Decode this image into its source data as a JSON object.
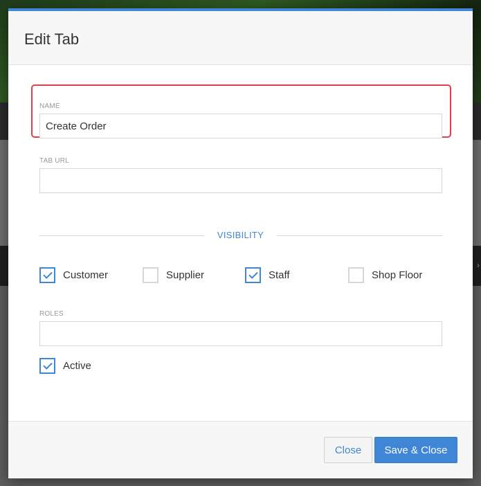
{
  "dialog": {
    "title": "Edit Tab"
  },
  "fields": {
    "name": {
      "label": "NAME",
      "value": "Create Order",
      "placeholder": ""
    },
    "tab_url": {
      "label": "TAB URL",
      "value": "",
      "placeholder": ""
    },
    "roles": {
      "label": "ROLES",
      "value": "",
      "placeholder": ""
    }
  },
  "visibility": {
    "heading": "VISIBILITY",
    "options": [
      {
        "label": "Customer",
        "checked": true
      },
      {
        "label": "Supplier",
        "checked": false
      },
      {
        "label": "Staff",
        "checked": true
      },
      {
        "label": "Shop Floor",
        "checked": false
      }
    ]
  },
  "active": {
    "label": "Active",
    "checked": true
  },
  "footer": {
    "close_label": "Close",
    "save_label": "Save & Close"
  },
  "colors": {
    "accent": "#3f86d6",
    "highlight": "#e0404a"
  },
  "icons": {
    "check": "check-icon",
    "chevron": "chevron-right-icon"
  }
}
